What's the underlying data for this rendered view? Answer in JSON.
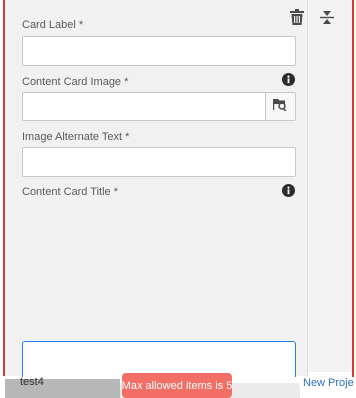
{
  "form": {
    "card_label": "Card Label *",
    "card_image": "Content Card Image *",
    "image_alt": "Image Alternate Text *",
    "card_title": "Content Card Title *"
  },
  "footer": {
    "item_text": "test4",
    "link_text": "New Proje"
  },
  "toast": {
    "message": "Max allowed items is 5"
  },
  "icons": {
    "delete": "trash-icon",
    "collapse": "collapse-icon",
    "info": "info-icon",
    "browse": "folder-search-icon"
  },
  "colors": {
    "error_border": "#d23a3a",
    "focus_border": "#2680eb",
    "toast_bg": "#f16f64"
  }
}
